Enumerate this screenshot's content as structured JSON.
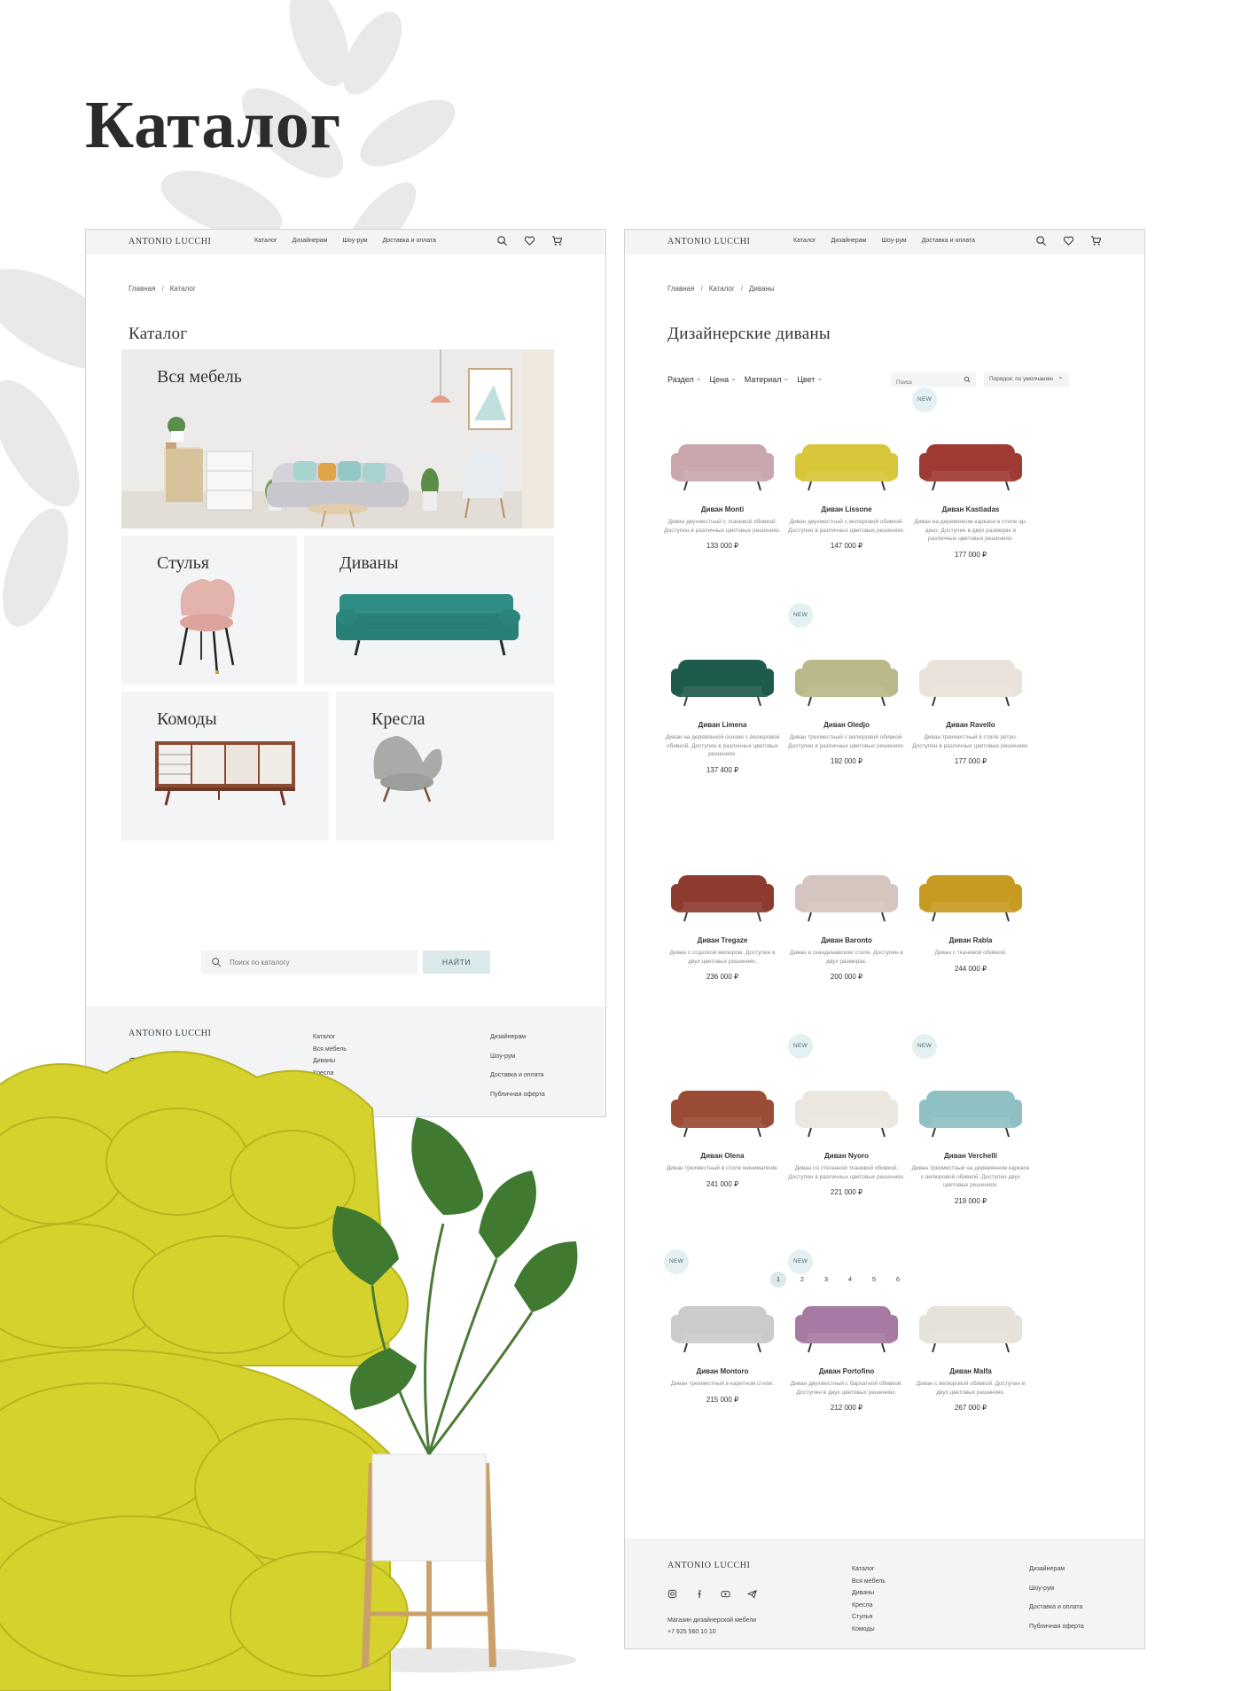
{
  "hero": {
    "title": "Каталог"
  },
  "header": {
    "logo": "ANTONIO LUCCHI",
    "nav": [
      "Каталог",
      "Дизайнерам",
      "Шоу-рум",
      "Доставка и оплата"
    ]
  },
  "left_page": {
    "breadcrumbs": [
      "Главная",
      "Каталог"
    ],
    "title": "Каталог",
    "tiles": [
      "Вся мебель",
      "Стулья",
      "Диваны",
      "Комоды",
      "Кресла"
    ],
    "search_placeholder": "Поиск по каталогу",
    "search_button": "НАЙТИ"
  },
  "right_page": {
    "breadcrumbs": [
      "Главная",
      "Каталог",
      "Диваны"
    ],
    "title": "Дизайнерские диваны",
    "filters": [
      "Раздел",
      "Цена",
      "Материал",
      "Цвет"
    ],
    "search_placeholder": "Поиск",
    "sort_label": "Порядок: по умолчанию",
    "badge_text": "NEW",
    "products": [
      {
        "name": "Диван Monti",
        "desc": "Диван двухместный с тканевой обивкой. Доступен в различных цветовых решениях.",
        "price": "133 000 ₽",
        "new": false,
        "color": "#c9a7ad"
      },
      {
        "name": "Диван Lissone",
        "desc": "Диван двухместный с велюровой обивкой. Доступен в различных цветовых решениях.",
        "price": "147 000 ₽",
        "new": false,
        "color": "#d8c53a"
      },
      {
        "name": "Диван Kastiadas",
        "desc": "Диван на деревянном каркасе в стиле ар-деко. Доступен в двух размерах и различных цветовых решениях.",
        "price": "177 000 ₽",
        "new": true,
        "color": "#9e3b32"
      },
      {
        "name": "Диван Limena",
        "desc": "Диван на деревянной основе с велюровой обивкой. Доступен в различных цветовых решениях.",
        "price": "137 400 ₽",
        "new": false,
        "color": "#1f5b4c"
      },
      {
        "name": "Диван Oledjo",
        "desc": "Диван трехместный с велюровой обивкой. Доступен в различных цветовых решениях.",
        "price": "192 000 ₽",
        "new": true,
        "color": "#b9b98a"
      },
      {
        "name": "Диван Ravello",
        "desc": "Диван трехместный в стиле ретро. Доступен в различных цветовых решениях.",
        "price": "177 000 ₽",
        "new": false,
        "color": "#e9e3db"
      },
      {
        "name": "Диван Tregaze",
        "desc": "Диван с отделкой велюром. Доступен в двух цветовых решениях.",
        "price": "236 000 ₽",
        "new": false,
        "color": "#8e3b2f"
      },
      {
        "name": "Диван Baronto",
        "desc": "Диван в скандинавском стиле. Доступен в двух размерах.",
        "price": "200 000 ₽",
        "new": false,
        "color": "#d5c4bf"
      },
      {
        "name": "Диван Rabla",
        "desc": "Диван с тканевой обивкой.",
        "price": "244 000 ₽",
        "new": false,
        "color": "#c79a22"
      },
      {
        "name": "Диван Olena",
        "desc": "Диван трехместный в стиле минимализм.",
        "price": "241 000 ₽",
        "new": false,
        "color": "#9a4c34"
      },
      {
        "name": "Диван Nyoro",
        "desc": "Диван со стеганной тканевой обивкой. Доступен в различных цветовых решениях.",
        "price": "221 000 ₽",
        "new": true,
        "color": "#ece7df"
      },
      {
        "name": "Диван Verchelli",
        "desc": "Диван трехместный на деревянном каркасе с велюровой обивкой. Доступен двух цветовых решениях.",
        "price": "219 000 ₽",
        "new": true,
        "color": "#8fc0c4"
      },
      {
        "name": "Диван Montoro",
        "desc": "Диван трехместный в каретном стиле.",
        "price": "215 000 ₽",
        "new": true,
        "color": "#c9cbcd"
      },
      {
        "name": "Диван Portofino",
        "desc": "Диван двухместный с бархатной обивкой. Доступен в двух цветовых решениях.",
        "price": "212 000 ₽",
        "new": true,
        "color": "#a67aa3"
      },
      {
        "name": "Диван Malfa",
        "desc": "Диван с велюровой обивкой. Доступен в двух цветовых решениях.",
        "price": "267 000 ₽",
        "new": false,
        "color": "#e6e1d9"
      }
    ],
    "pages": [
      "1",
      "2",
      "3",
      "4",
      "5",
      "6"
    ]
  },
  "footer": {
    "logo": "ANTONIO LUCCHI",
    "desc1": "Магазин дизайнерской мебели",
    "phone": "+7 925 560 10 10",
    "col1": [
      "Каталог",
      "Вся мебель",
      "Диваны",
      "Кресла",
      "Стулья",
      "Комоды"
    ],
    "col2": [
      "Дизайнерам",
      "Шоу-рум",
      "Доставка и оплата",
      "Публичная оферта"
    ]
  },
  "colors": {
    "accent": "#dbe9ea",
    "panel": "#f3f4f5",
    "text": "#2c2c2c",
    "yellow_sofa": "#d4d12e"
  },
  "icons": [
    "search-icon",
    "heart-icon",
    "cart-icon",
    "instagram-icon",
    "facebook-icon",
    "youtube-icon",
    "telegram-icon"
  ]
}
